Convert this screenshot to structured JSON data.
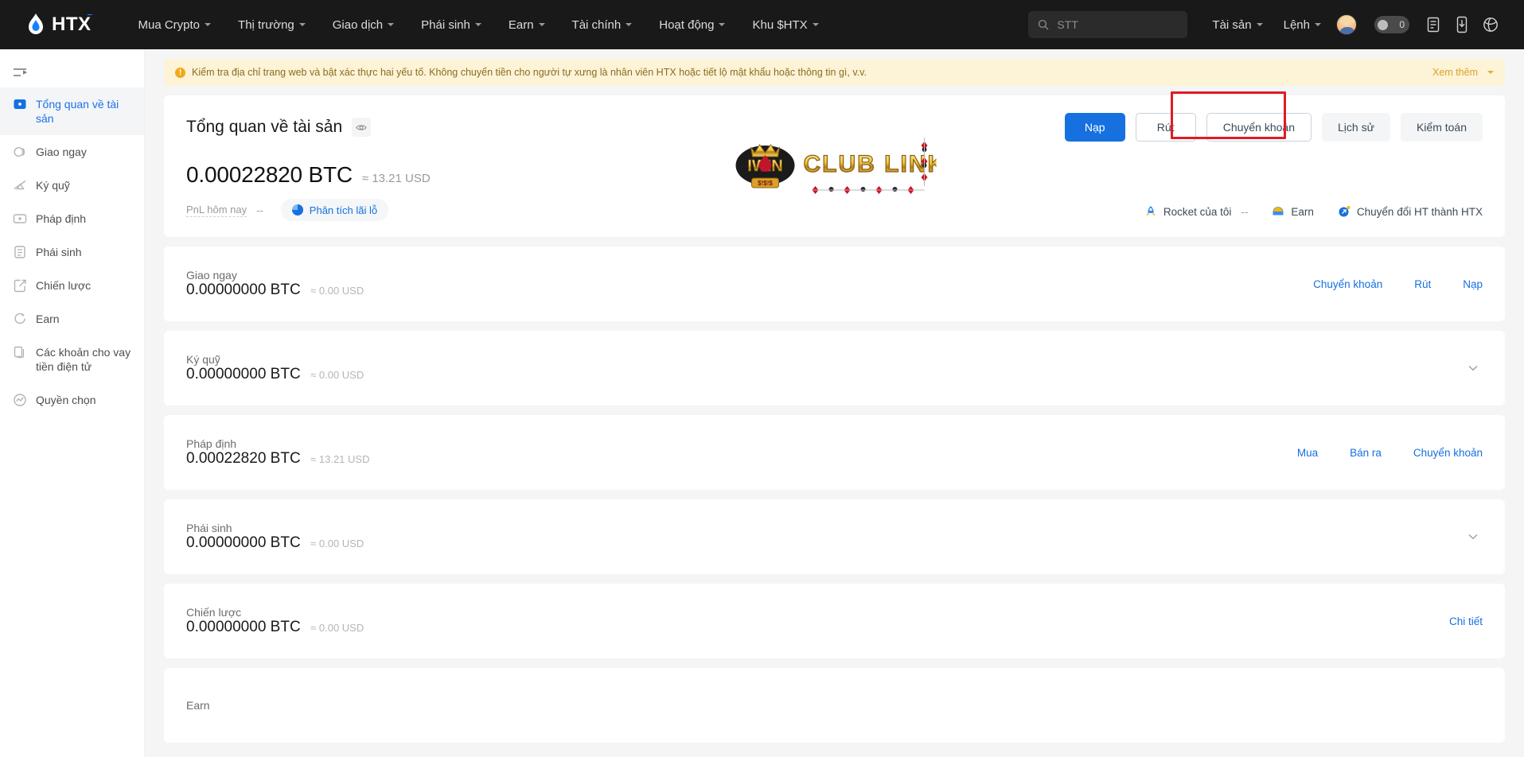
{
  "topnav": {
    "brand": {
      "text": "HTX",
      "logo_icon": "htx-flame-logo"
    },
    "items": [
      {
        "label": "Mua Crypto",
        "has_caret": true
      },
      {
        "label": "Thị trường",
        "has_caret": true
      },
      {
        "label": "Giao dịch",
        "has_caret": true
      },
      {
        "label": "Phái sinh",
        "has_caret": true
      },
      {
        "label": "Earn",
        "has_caret": true
      },
      {
        "label": "Tài chính",
        "has_caret": true
      },
      {
        "label": "Hoạt động",
        "has_caret": true
      },
      {
        "label": "Khu $HTX",
        "has_caret": true
      }
    ],
    "search": {
      "placeholder": "STT",
      "value": "",
      "icon": "search-icon"
    },
    "right_items": [
      {
        "label": "Tài sản",
        "has_caret": true
      },
      {
        "label": "Lệnh",
        "has_caret": true
      }
    ],
    "toggle_count": "0",
    "icons": [
      "avatar",
      "eye-count-pill",
      "orders-icon",
      "download-icon",
      "support-icon"
    ]
  },
  "sidebar": {
    "collapse_icon": "collapse-sidebar-icon",
    "items": [
      {
        "label": "Tổng quan về tài sản",
        "icon": "overview-icon",
        "active": true
      },
      {
        "label": "Giao ngay",
        "icon": "spot-icon",
        "active": false
      },
      {
        "label": "Ký quỹ",
        "icon": "margin-icon",
        "active": false
      },
      {
        "label": "Pháp định",
        "icon": "fiat-icon",
        "active": false
      },
      {
        "label": "Phái sinh",
        "icon": "derivatives-icon",
        "active": false
      },
      {
        "label": "Chiến lược",
        "icon": "strategy-icon",
        "active": false
      },
      {
        "label": "Earn",
        "icon": "earn-icon",
        "active": false
      },
      {
        "label": "Các khoản cho vay tiền điện tử",
        "icon": "loans-icon",
        "active": false
      },
      {
        "label": "Quyền chọn",
        "icon": "options-icon",
        "active": false
      }
    ]
  },
  "banner": {
    "icon": "warning-icon",
    "text": "Kiểm tra địa chỉ trang web và bật xác thực hai yếu tố. Không chuyển tiền cho người tự xưng là nhân viên HTX hoặc tiết lộ mật khẩu hoặc thông tin gì, v.v.",
    "more_label": "Xem thêm"
  },
  "overview": {
    "title": "Tổng quan về tài sản",
    "eye_icon": "eye-icon",
    "buttons": [
      {
        "label": "Nạp",
        "style": "primary",
        "name": "deposit-button"
      },
      {
        "label": "Rút",
        "style": "outline",
        "name": "withdraw-button"
      },
      {
        "label": "Chuyển khoản",
        "style": "outline",
        "name": "transfer-button",
        "highlighted": true
      },
      {
        "label": "Lịch sử",
        "style": "ghost",
        "name": "history-button"
      },
      {
        "label": "Kiểm toán",
        "style": "ghost",
        "name": "audit-button"
      }
    ],
    "balance_amount": "0.00022820 BTC",
    "balance_usd": "≈ 13.21 USD",
    "pnl_label": "PnL hôm nay",
    "pnl_value": "--",
    "pnl_button": "Phân tích lãi lỗ",
    "center_logo_text": "IWIN CLUB LINK",
    "links": [
      {
        "label": "Rocket của tôi",
        "icon": "rocket-icon",
        "value": "--"
      },
      {
        "label": "Earn",
        "icon": "earn-pot-icon",
        "value": ""
      },
      {
        "label": "Chuyển đổi HT thành HTX",
        "icon": "convert-icon",
        "value": ""
      }
    ]
  },
  "assets": [
    {
      "name": "Giao ngay",
      "amount": "0.00000000 BTC",
      "usd": "≈ 0.00 USD",
      "links": [
        "Chuyển khoản",
        "Rút",
        "Nạp"
      ],
      "chevron": false
    },
    {
      "name": "Ký quỹ",
      "amount": "0.00000000 BTC",
      "usd": "≈ 0.00 USD",
      "links": [],
      "chevron": true
    },
    {
      "name": "Pháp định",
      "amount": "0.00022820 BTC",
      "usd": "≈ 13.21 USD",
      "links": [
        "Mua",
        "Bán ra",
        "Chuyển khoản"
      ],
      "chevron": false
    },
    {
      "name": "Phái sinh",
      "amount": "0.00000000 BTC",
      "usd": "≈ 0.00 USD",
      "links": [],
      "chevron": true
    },
    {
      "name": "Chiến lược",
      "amount": "0.00000000 BTC",
      "usd": "≈ 0.00 USD",
      "links": [
        "Chi tiết"
      ],
      "chevron": false
    },
    {
      "name": "Earn",
      "amount": "",
      "usd": "",
      "links": [],
      "chevron": false
    }
  ],
  "colors": {
    "accent": "#1670e0",
    "nav_bg": "#191919",
    "banner_bg": "#fdf3d7",
    "highlight": "#e01b24"
  }
}
